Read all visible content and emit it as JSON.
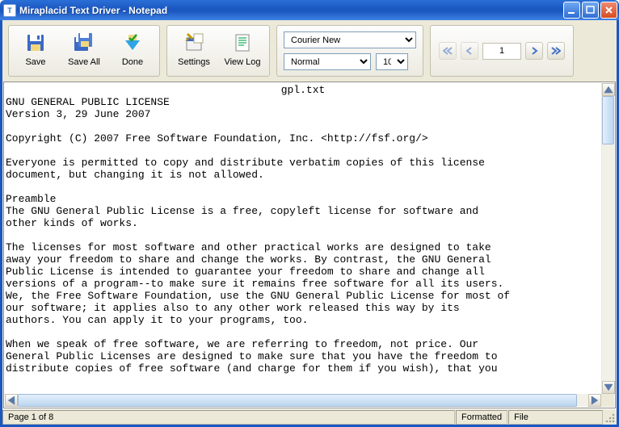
{
  "window": {
    "title": "Miraplacid Text Driver - Notepad"
  },
  "toolbar": {
    "save": "Save",
    "save_all": "Save All",
    "done": "Done",
    "settings": "Settings",
    "view_log": "View Log"
  },
  "font": {
    "name": "Courier New",
    "style": "Normal",
    "size": "10"
  },
  "pager": {
    "current": "1"
  },
  "document": {
    "filename": "gpl.txt",
    "body": "GNU GENERAL PUBLIC LICENSE\nVersion 3, 29 June 2007\n\nCopyright (C) 2007 Free Software Foundation, Inc. <http://fsf.org/>\n\nEveryone is permitted to copy and distribute verbatim copies of this license\ndocument, but changing it is not allowed.\n\nPreamble\nThe GNU General Public License is a free, copyleft license for software and\nother kinds of works.\n\nThe licenses for most software and other practical works are designed to take\naway your freedom to share and change the works. By contrast, the GNU General\nPublic License is intended to guarantee your freedom to share and change all\nversions of a program--to make sure it remains free software for all its users.\nWe, the Free Software Foundation, use the GNU General Public License for most of\nour software; it applies also to any other work released this way by its\nauthors. You can apply it to your programs, too.\n\nWhen we speak of free software, we are referring to freedom, not price. Our\nGeneral Public Licenses are designed to make sure that you have the freedom to\ndistribute copies of free software (and charge for them if you wish), that you"
  },
  "status": {
    "page": "Page 1 of 8",
    "mode": "Formatted",
    "source": "File"
  }
}
